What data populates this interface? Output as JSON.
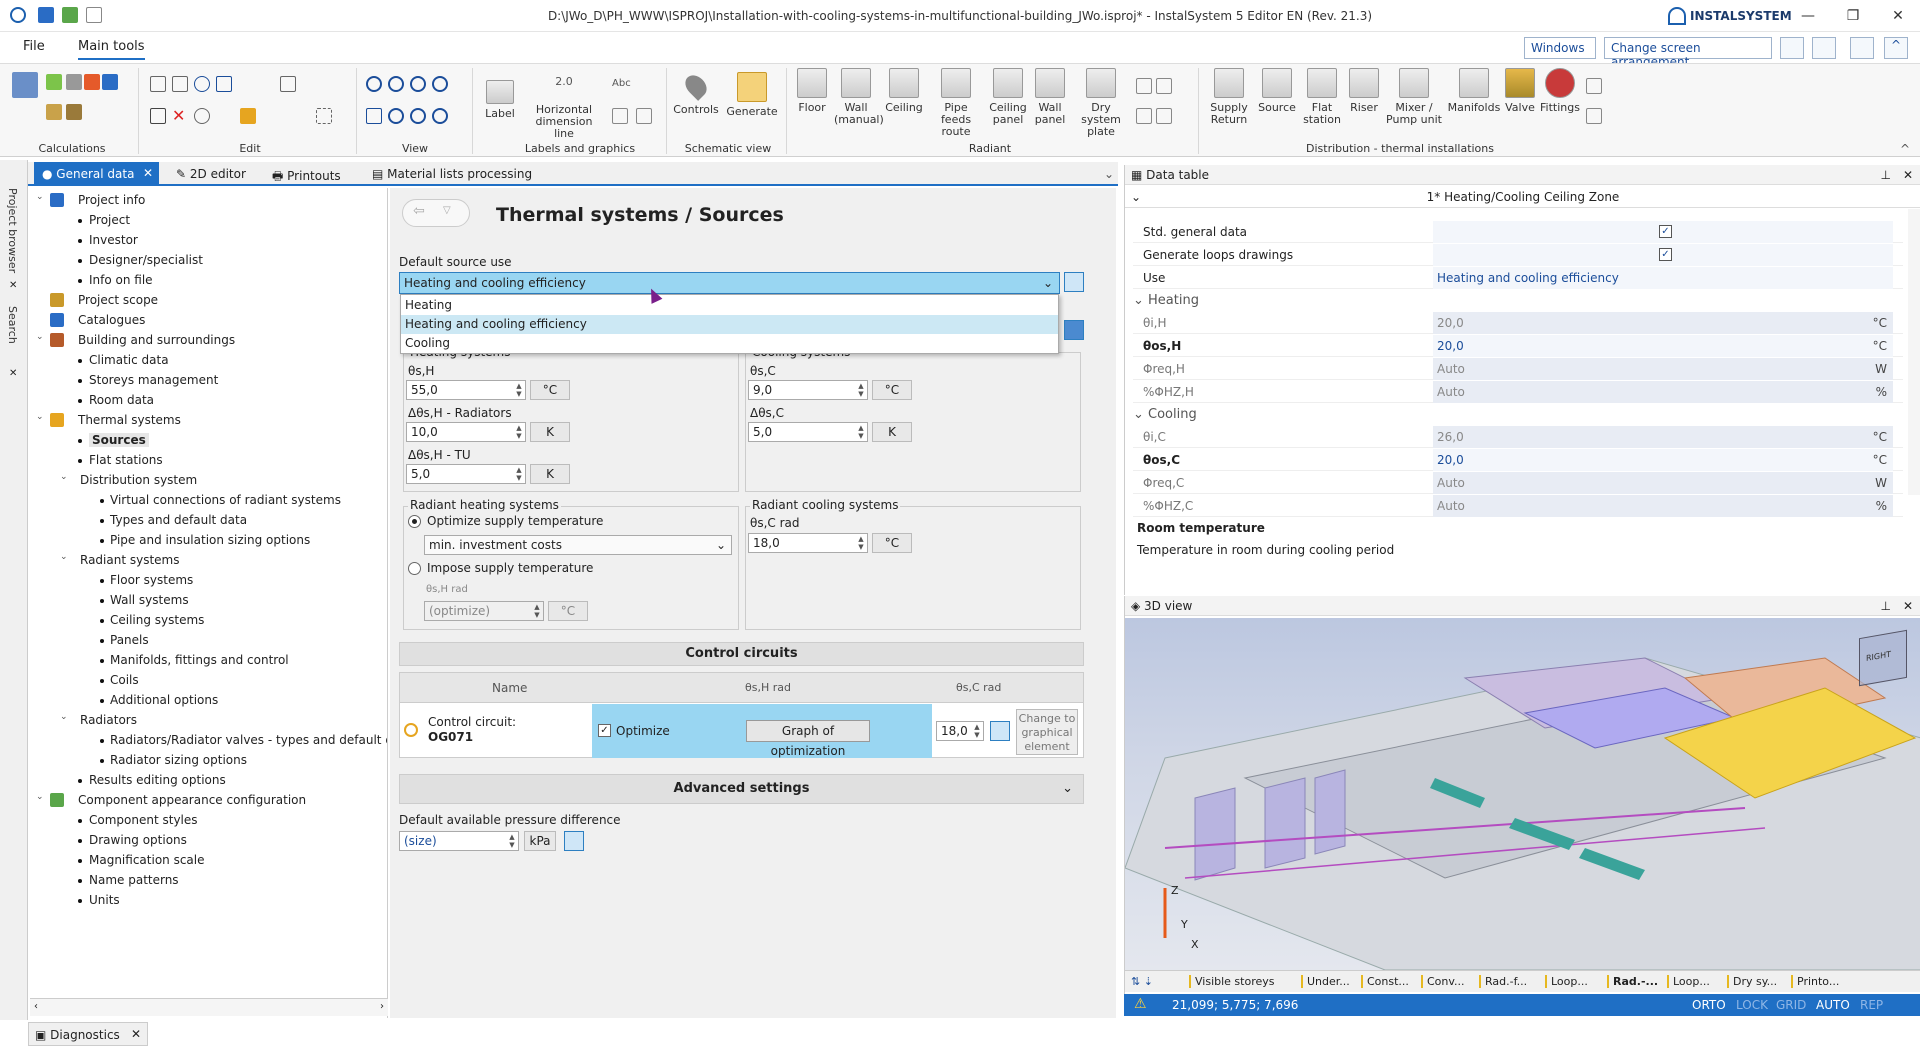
{
  "window": {
    "title": "D:\\JWo_D\\PH_WWW\\ISPROJ\\Installation-with-cooling-systems-in-multifunctional-building_JWo.isproj* - InstalSystem 5 Editor EN (Rev. 21.3)",
    "brand": "INSTALSYSTEM",
    "minimize": "—",
    "restore": "❐",
    "close": "✕"
  },
  "menu": {
    "file": "File",
    "main_tools": "Main tools",
    "windows": "Windows",
    "change_screen": "Change screen arrangement"
  },
  "ribbon": {
    "groups": {
      "calculations": "Calculations",
      "edit": "Edit",
      "view": "View",
      "labels": "Labels and graphics",
      "schematic": "Schematic view",
      "radiant": "Radiant",
      "distribution": "Distribution - thermal installations"
    },
    "buttons": {
      "label": "Label",
      "horizontal_dim_1": "Horizontal",
      "horizontal_dim_2": "dimension line",
      "dim_value": "2.0",
      "abc": "Abc",
      "controls": "Controls",
      "generate": "Generate",
      "floor": "Floor",
      "wall_manual_1": "Wall",
      "wall_manual_2": "(manual)",
      "ceiling": "Ceiling",
      "pipe_feeds_1": "Pipe feeds",
      "pipe_feeds_2": "route",
      "ceiling_panel_1": "Ceiling",
      "ceiling_panel_2": "panel",
      "wall_panel_1": "Wall",
      "wall_panel_2": "panel",
      "dry_system_1": "Dry system",
      "dry_system_2": "plate",
      "supply_return_1": "Supply",
      "supply_return_2": "Return",
      "source": "Source",
      "flat_station_1": "Flat",
      "flat_station_2": "station",
      "riser": "Riser",
      "mixer_1": "Mixer /",
      "mixer_2": "Pump unit",
      "manifolds": "Manifolds",
      "valve": "Valve",
      "fittings": "Fittings"
    }
  },
  "side_tabs": {
    "project_browser": "Project browser",
    "search": "Search"
  },
  "doc_tabs": {
    "general_data": "● General data",
    "editor_2d": "2D editor",
    "printouts": "Printouts",
    "material_lists": "Material lists processing"
  },
  "tree": [
    {
      "label": "Project info",
      "level": 0,
      "expander": "⌄",
      "icon": "info"
    },
    {
      "label": "Project",
      "level": 1
    },
    {
      "label": "Investor",
      "level": 1
    },
    {
      "label": "Designer/specialist",
      "level": 1
    },
    {
      "label": "Info on file",
      "level": 1
    },
    {
      "label": "Project scope",
      "level": 0,
      "icon": "scope"
    },
    {
      "label": "Catalogues",
      "level": 0,
      "icon": "catalogue"
    },
    {
      "label": "Building and surroundings",
      "level": 0,
      "expander": "⌄",
      "icon": "building"
    },
    {
      "label": "Climatic data",
      "level": 1
    },
    {
      "label": "Storeys management",
      "level": 1
    },
    {
      "label": "Room data",
      "level": 1
    },
    {
      "label": "Thermal systems",
      "level": 0,
      "expander": "⌄",
      "icon": "thermal"
    },
    {
      "label": "Sources",
      "level": 1,
      "selected": true
    },
    {
      "label": "Flat stations",
      "level": 1
    },
    {
      "label": "Distribution system",
      "level": 1,
      "expander": "⌄",
      "folder": true
    },
    {
      "label": "Virtual connections of radiant systems",
      "level": 2
    },
    {
      "label": "Types and default data",
      "level": 2
    },
    {
      "label": "Pipe and insulation sizing options",
      "level": 2
    },
    {
      "label": "Radiant systems",
      "level": 1,
      "expander": "⌄",
      "folder": true
    },
    {
      "label": "Floor systems",
      "level": 2
    },
    {
      "label": "Wall systems",
      "level": 2
    },
    {
      "label": "Ceiling systems",
      "level": 2
    },
    {
      "label": "Panels",
      "level": 2
    },
    {
      "label": "Manifolds, fittings and control",
      "level": 2
    },
    {
      "label": "Coils",
      "level": 2
    },
    {
      "label": "Additional options",
      "level": 2
    },
    {
      "label": "Radiators",
      "level": 1,
      "expander": "⌄",
      "folder": true
    },
    {
      "label": "Radiators/Radiator valves - types and default data",
      "level": 2
    },
    {
      "label": "Radiator sizing options",
      "level": 2
    },
    {
      "label": "Results editing options",
      "level": 1
    },
    {
      "label": "Component appearance configuration",
      "level": 0,
      "expander": "⌄",
      "icon": "appearance"
    },
    {
      "label": "Component styles",
      "level": 1
    },
    {
      "label": "Drawing options",
      "level": 1
    },
    {
      "label": "Magnification scale",
      "level": 1
    },
    {
      "label": "Name patterns",
      "level": 1
    },
    {
      "label": "Units",
      "level": 1
    }
  ],
  "form": {
    "page_title": "Thermal systems / Sources",
    "default_source_use_label": "Default source use",
    "dropdown_value": "Heating and cooling efficiency",
    "dropdown_options": [
      "Heating",
      "Heating and cooling efficiency",
      "Cooling"
    ],
    "heating_group": "Heating systems",
    "cooling_group": "Cooling systems",
    "theta_sH": "θs,H",
    "theta_sH_value": "55,0",
    "dtheta_rad_label": "Δθs,H - Radiators",
    "dtheta_rad_value": "10,0",
    "dtheta_tu_label": "Δθs,H - TU",
    "dtheta_tu_value": "5,0",
    "theta_sC": "θs,C",
    "theta_sC_value": "9,0",
    "dtheta_sC": "Δθs,C",
    "dtheta_sC_value": "5,0",
    "unit_c": "°C",
    "unit_k": "K",
    "radiant_heating_group": "Radiant heating systems",
    "optimize_supply": "Optimize supply temperature",
    "min_cost": "min. investment costs",
    "impose_supply": "Impose supply temperature",
    "theta_sHrad": "θs,H rad",
    "optimize_value": "(optimize)",
    "radiant_cooling_group": "Radiant cooling systems",
    "theta_sCrad": "θs,C rad",
    "theta_sCrad_value": "18,0"
  },
  "control_circuits": {
    "title": "Control circuits",
    "col_name": "Name",
    "col_heat": "θs,H rad",
    "col_cool": "θs,C rad",
    "row_label": "Control circuit:",
    "row_id": "OG071",
    "optimize": "Optimize",
    "graph_button": "Graph of optimization",
    "cool_value": "18,0",
    "change_graphic_1": "Change to",
    "change_graphic_2": "graphical",
    "change_graphic_3": "element"
  },
  "advanced": {
    "title": "Advanced settings",
    "pressure_label": "Default available pressure difference",
    "pressure_value": "(size)",
    "pressure_unit": "kPa"
  },
  "data_table": {
    "panel_title": "Data table",
    "zone_title": "1* Heating/Cooling Ceiling Zone",
    "rows_top": [
      {
        "name": "Std. general data",
        "value": "✓"
      },
      {
        "name": "Generate loops drawings",
        "value": "✓"
      },
      {
        "name": "Use",
        "value": "Heating and cooling efficiency"
      }
    ],
    "heating_section": "Heating",
    "heating_rows": [
      {
        "name": "θi,H",
        "value": "20,0",
        "unit": "°C"
      },
      {
        "name": "θos,H",
        "value": "20,0",
        "unit": "°C"
      },
      {
        "name": "Φreq,H",
        "value": "Auto",
        "unit": "W"
      },
      {
        "name": "%ΦHZ,H",
        "value": "Auto",
        "unit": "%"
      }
    ],
    "cooling_section": "Cooling",
    "cooling_rows": [
      {
        "name": "θi,C",
        "value": "26,0",
        "unit": "°C"
      },
      {
        "name": "θos,C",
        "value": "20,0",
        "unit": "°C"
      },
      {
        "name": "Φreq,C",
        "value": "Auto",
        "unit": "W"
      },
      {
        "name": "%ΦHZ,C",
        "value": "Auto",
        "unit": "%"
      }
    ],
    "desc_title": "Room temperature",
    "desc_text": "Temperature in room during cooling period"
  },
  "view3d": {
    "panel_title": "3D view",
    "cube_label": "RIGHT",
    "axis_z": "Z",
    "axis_y": "Y",
    "axis_x": "X",
    "storey_tabs": [
      "Visible storeys",
      "Under...",
      "Const...",
      "Conv...",
      "Rad.-f...",
      "Loop...",
      "Rad.-...",
      "Loop...",
      "Dry sy...",
      "Printo..."
    ],
    "coords": "21,099; 5,775; 7,696",
    "status": [
      "ORTO",
      "LOCK",
      "GRID",
      "AUTO",
      "REP"
    ]
  },
  "diagnostics": "Diagnostics"
}
